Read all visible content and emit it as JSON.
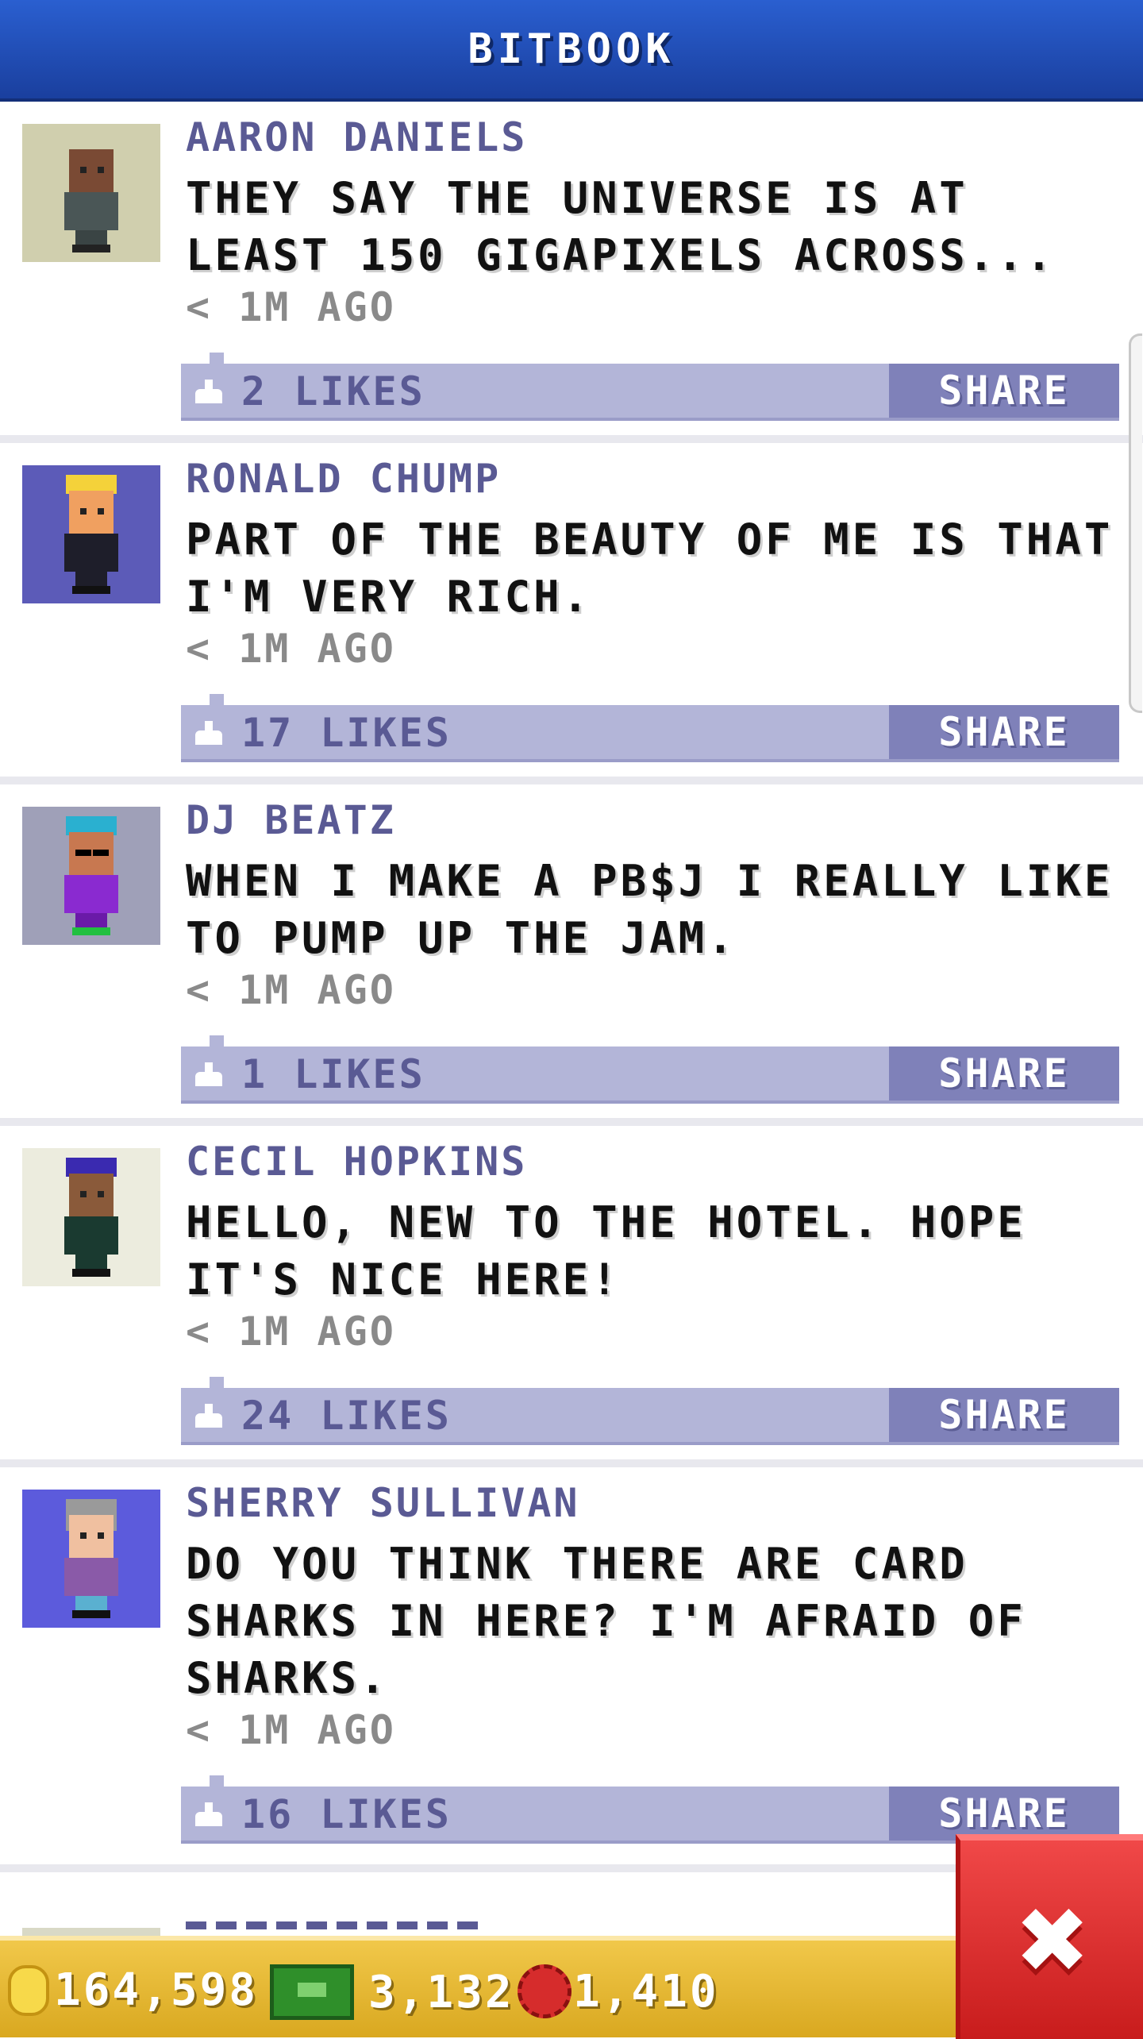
{
  "header": {
    "title": "BITBOOK"
  },
  "posts": [
    {
      "name": "AARON DANIELS",
      "message": "THEY SAY THE UNIVERSE IS AT LEAST 150 GIGAPIXELS ACROSS...",
      "time": "< 1M AGO",
      "likes": "2 LIKES",
      "share": "SHARE",
      "avatar_bg": "#d0cfae"
    },
    {
      "name": "RONALD CHUMP",
      "message": "PART OF THE BEAUTY OF ME IS THAT I'M VERY RICH.",
      "time": "< 1M AGO",
      "likes": "17 LIKES",
      "share": "SHARE",
      "avatar_bg": "#5c5bb8"
    },
    {
      "name": "DJ BEATZ",
      "message": "WHEN I MAKE A PB$J I REALLY LIKE TO PUMP UP THE JAM.",
      "time": "< 1M AGO",
      "likes": "1 LIKES",
      "share": "SHARE",
      "avatar_bg": "#9fa0b8"
    },
    {
      "name": "CECIL HOPKINS",
      "message": "HELLO, NEW TO THE HOTEL. HOPE IT'S NICE HERE!",
      "time": "< 1M AGO",
      "likes": "24 LIKES",
      "share": "SHARE",
      "avatar_bg": "#ececde"
    },
    {
      "name": "SHERRY SULLIVAN",
      "message": "DO YOU THINK THERE ARE CARD SHARKS IN HERE? I'M AFRAID OF SHARKS.",
      "time": "< 1M AGO",
      "likes": "16 LIKES",
      "share": "SHARE",
      "avatar_bg": "#5c5bdc"
    }
  ],
  "currency": {
    "coins": "164,598",
    "bux": "3,132",
    "chips": "1,410"
  },
  "colors": {
    "header": "#1f4fb8",
    "like_bar": "#b3b5d8",
    "share_button": "#7f81b9",
    "name_text": "#5a5a94",
    "bottom_bar": "#e6b930",
    "close_button": "#e03030"
  }
}
